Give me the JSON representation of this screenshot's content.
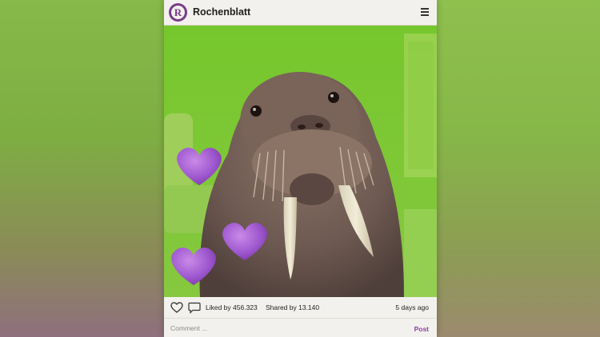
{
  "header": {
    "avatar_letter": "R",
    "brand": "Rochenblatt",
    "menu_icon": "hamburger-menu-icon"
  },
  "post": {
    "image_subject": "walrus",
    "stickers": [
      "purple-heart",
      "purple-heart",
      "purple-heart"
    ],
    "liked_text": "Liked by 456.323",
    "shared_text": "Shared by 13.140",
    "date_text": "5 days ago",
    "like_icon": "heart-outline-icon",
    "comment_icon": "speech-bubble-icon"
  },
  "comment": {
    "placeholder": "Comment ...",
    "post_label": "Post"
  },
  "colors": {
    "accent": "#8b3fa0",
    "avatar": "#7a3a8c",
    "green_screen": "#7ec53a",
    "heart": "#a15ad0"
  }
}
